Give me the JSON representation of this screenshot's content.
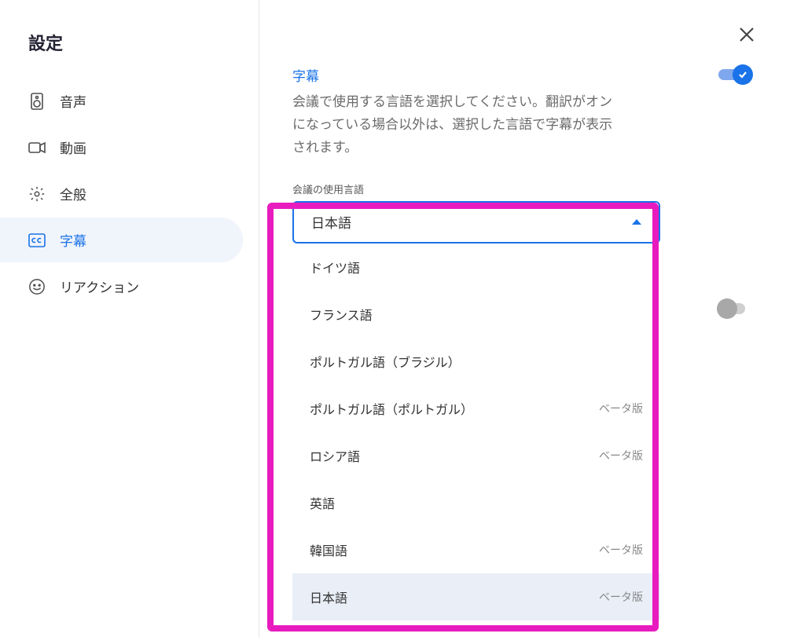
{
  "sidebar": {
    "title": "設定",
    "items": [
      {
        "label": "音声",
        "icon": "speaker-icon"
      },
      {
        "label": "動画",
        "icon": "video-icon"
      },
      {
        "label": "全般",
        "icon": "gear-icon"
      },
      {
        "label": "字幕",
        "icon": "cc-icon"
      },
      {
        "label": "リアクション",
        "icon": "smile-icon"
      }
    ]
  },
  "main": {
    "section_title": "字幕",
    "description": "会議で使用する言語を選択してください。翻訳がオンになっている場合以外は、選択した言語で字幕が表示されます。",
    "field_label": "会議の使用言語",
    "selected_value": "日本語",
    "badge_beta": "ベータ版",
    "options": [
      {
        "label": "ドイツ語",
        "beta": false
      },
      {
        "label": "フランス語",
        "beta": false
      },
      {
        "label": "ポルトガル語（ブラジル）",
        "beta": false
      },
      {
        "label": "ポルトガル語（ポルトガル）",
        "beta": true
      },
      {
        "label": "ロシア語",
        "beta": true
      },
      {
        "label": "英語",
        "beta": false
      },
      {
        "label": "韓国語",
        "beta": true
      },
      {
        "label": "日本語",
        "beta": true,
        "selected": true
      }
    ]
  }
}
